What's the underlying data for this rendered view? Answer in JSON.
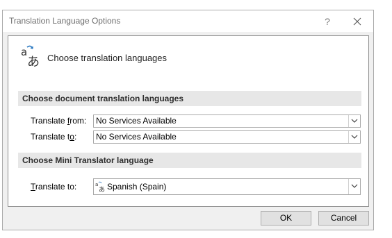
{
  "window": {
    "title": "Translation Language Options",
    "help_glyph": "?",
    "close_glyph": "✕"
  },
  "header": {
    "text": "Choose translation languages",
    "icon": "translate-icon"
  },
  "doc_section": {
    "title": "Choose document translation languages",
    "from_label_pre": "Translate ",
    "from_label_ul": "f",
    "from_label_post": "rom:",
    "from_value": "No Services Available",
    "to_label_pre": "Translate t",
    "to_label_ul": "o",
    "to_label_post": ":",
    "to_value": "No Services Available"
  },
  "mini_section": {
    "title": "Choose Mini Translator language",
    "to_label_ul": "T",
    "to_label_post": "ranslate to:",
    "to_value": "Spanish (Spain)"
  },
  "buttons": {
    "ok": "OK",
    "cancel": "Cancel"
  }
}
